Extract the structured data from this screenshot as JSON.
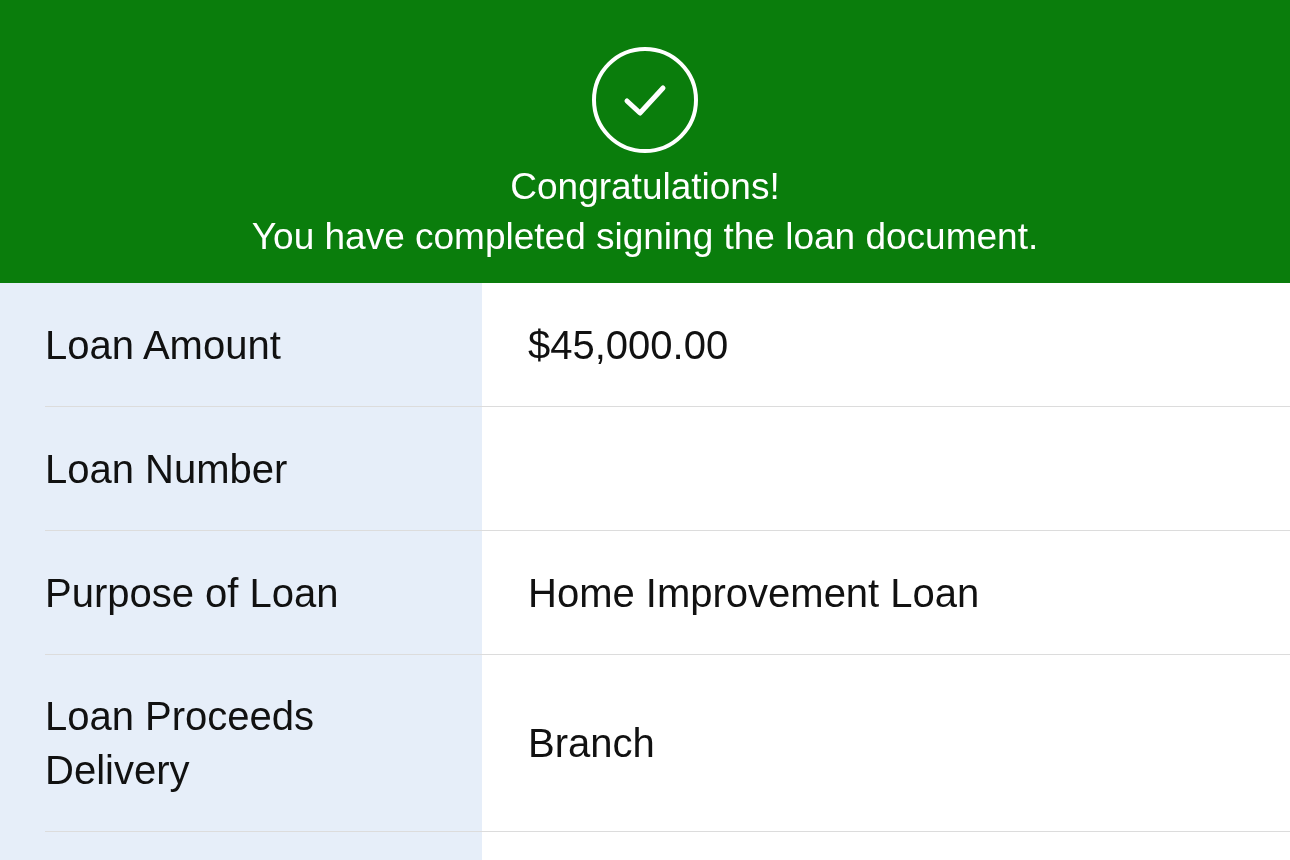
{
  "banner": {
    "title": "Congratulations!",
    "message": "You have completed signing the loan document."
  },
  "details": [
    {
      "label": "Loan Amount",
      "value": "$45,000.00"
    },
    {
      "label": "Loan Number"
    },
    {
      "label": "Purpose of Loan",
      "value": "Home Improvement Loan"
    },
    {
      "label": "Loan Proceeds Delivery",
      "value": "Branch"
    }
  ]
}
